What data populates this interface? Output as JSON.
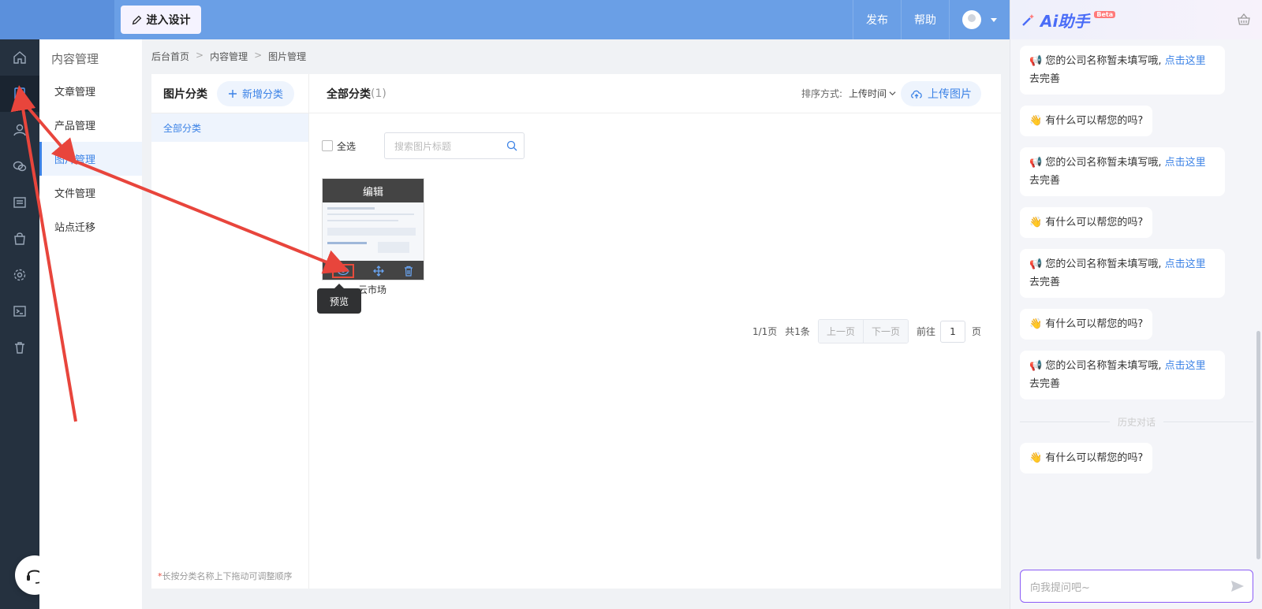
{
  "topbar": {
    "design_button": "进入设计",
    "publish": "发布",
    "help": "帮助"
  },
  "rail": {
    "items": [
      "home-icon",
      "content-icon",
      "member-icon",
      "wechat-icon",
      "list-icon",
      "shop-icon",
      "settings-icon",
      "terminal-icon",
      "trash-icon"
    ]
  },
  "submenu": {
    "title": "内容管理",
    "items": [
      "文章管理",
      "产品管理",
      "图片管理",
      "文件管理",
      "站点迁移"
    ]
  },
  "breadcrumb": [
    "后台首页",
    "内容管理",
    "图片管理"
  ],
  "categories": {
    "title": "图片分类",
    "add_button": "新增分类",
    "items": [
      "全部分类"
    ],
    "tip_star": "*",
    "tip": "长按分类名称上下拖动可调整顺序"
  },
  "images": {
    "title": "全部分类",
    "count": "(1)",
    "sort_label": "排序方式:",
    "sort_value": "上传时间",
    "upload_button": "上传图片",
    "select_all": "全选",
    "search_placeholder": "搜索图片标题",
    "thumb_edit": "编辑",
    "thumb_name": "云市场",
    "tooltip": "预览"
  },
  "pager": {
    "page_info": "1/1页",
    "total": "共1条",
    "prev": "上一页",
    "next": "下一页",
    "goto": "前往",
    "page_value": "1",
    "page_unit": "页"
  },
  "ai": {
    "logo": "Ai助手",
    "beta": "Beta",
    "history_label": "历史对话",
    "input_placeholder": "向我提问吧~",
    "msg_company_pre": "您的公司名称暂未填写哦,",
    "msg_company_link": "点击这里",
    "msg_company_post": "去完善",
    "msg_help": "有什么可以帮您的吗?"
  },
  "colors": {
    "topbar": "#6a9fe6",
    "rail": "#25313f",
    "accent": "#3b82e6",
    "arrow": "#e8453c",
    "ai_input_border": "#8b5cf6"
  }
}
